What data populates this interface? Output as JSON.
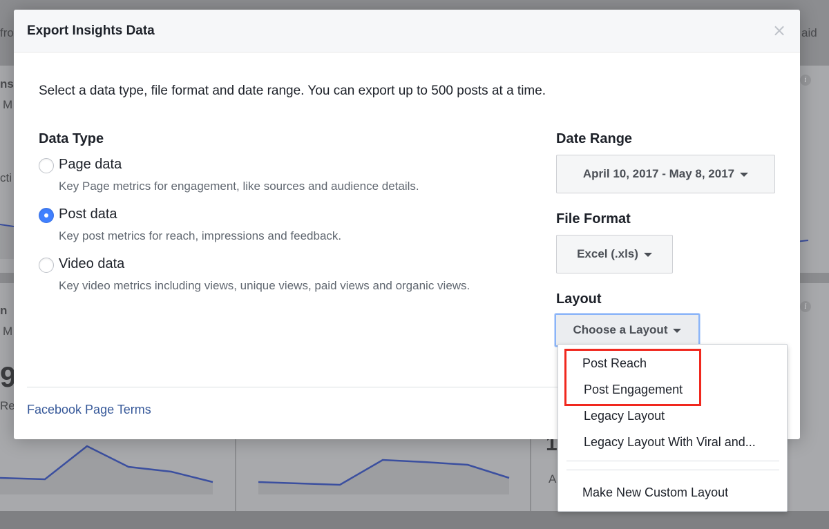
{
  "background": {
    "top_left_text": "fro",
    "top_right_text": "aid",
    "left_frag_1": "ns",
    "left_frag_2": "M",
    "left_frag_3": "cti",
    "left_frag_4": "n",
    "left_frag_5": "M",
    "big_number": "9",
    "left_frag_6": "Re",
    "right_frag_1": "1",
    "right_frag_2": "A"
  },
  "modal": {
    "title": "Export Insights Data",
    "close_label": "×",
    "intro": "Select a data type, file format and date range. You can export up to 500 posts at a time.",
    "data_type": {
      "heading": "Data Type",
      "options": [
        {
          "label": "Page data",
          "description": "Key Page metrics for engagement, like sources and audience details.",
          "checked": false
        },
        {
          "label": "Post data",
          "description": "Key post metrics for reach, impressions and feedback.",
          "checked": true
        },
        {
          "label": "Video data",
          "description": "Key video metrics including views, unique views, paid views and organic views.",
          "checked": false
        }
      ]
    },
    "date_range": {
      "heading": "Date Range",
      "value": "April 10, 2017 - May 8, 2017"
    },
    "file_format": {
      "heading": "File Format",
      "value": "Excel (.xls)"
    },
    "layout": {
      "heading": "Layout",
      "value": "Choose a Layout"
    },
    "footer_link": "Facebook Page Terms"
  },
  "layout_menu": {
    "items": [
      "Post Reach",
      "Post Engagement",
      "Legacy Layout",
      "Legacy Layout With Viral and..."
    ],
    "footer_item": "Make New Custom Layout"
  },
  "colors": {
    "accent": "#4080ff",
    "link": "#365899",
    "highlight": "#f0281e",
    "chart_line": "#3b4f9f"
  }
}
